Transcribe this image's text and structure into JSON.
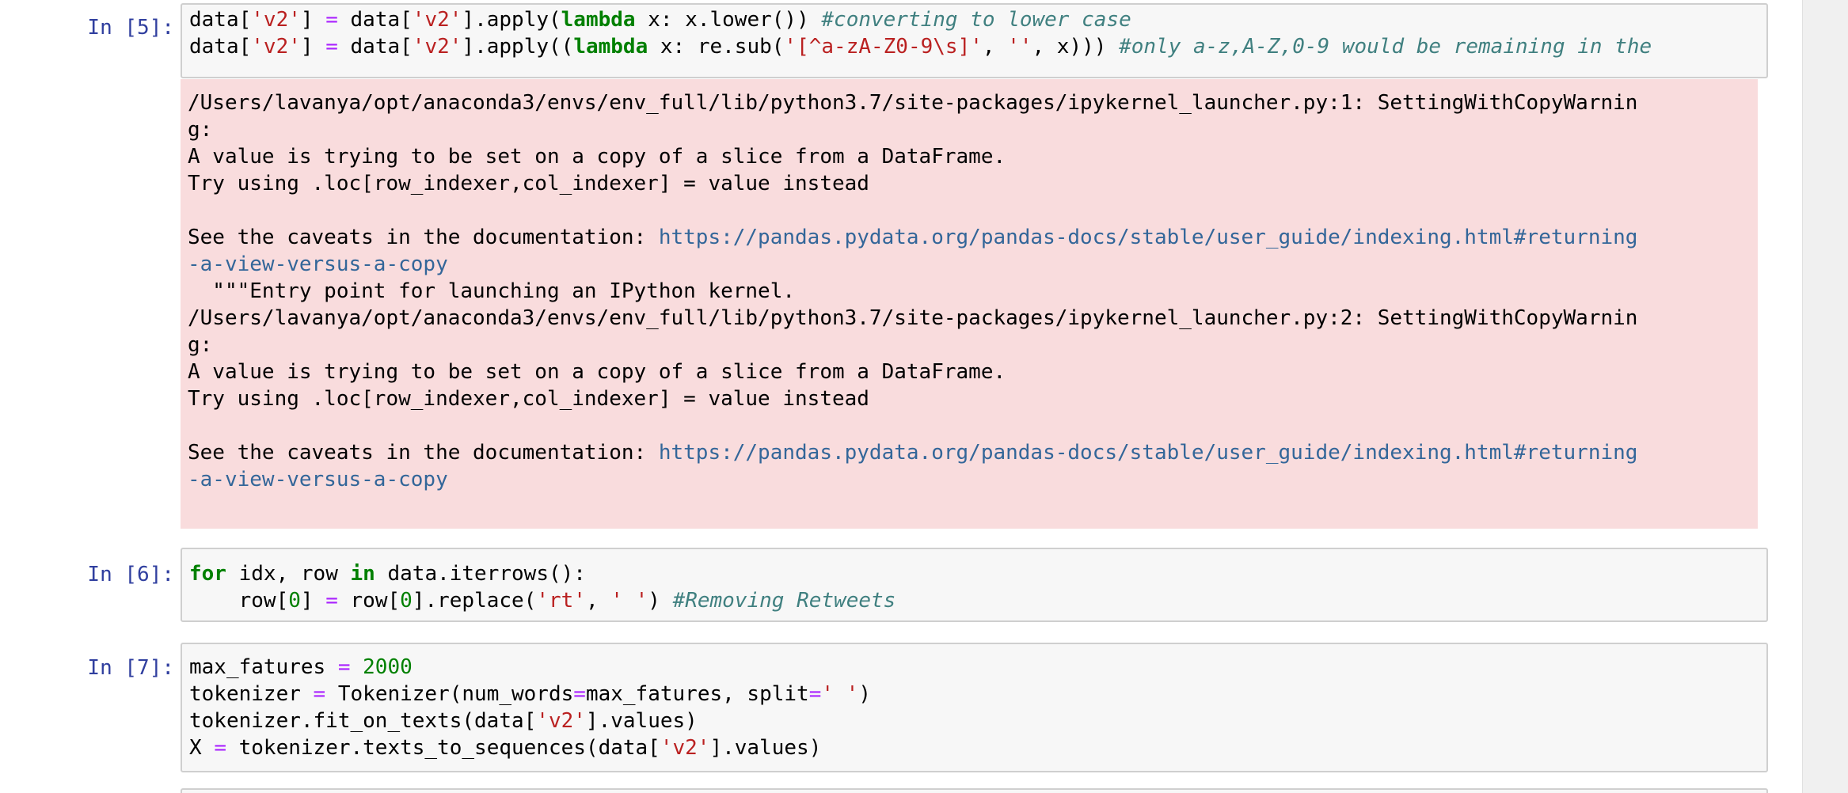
{
  "cells": [
    {
      "prompt": "In [5]:",
      "code": {
        "l1": {
          "a": "data[",
          "b": "'v2'",
          "c": "] ",
          "d": "=",
          "e": " data[",
          "f": "'v2'",
          "g": "].apply(",
          "h": "lambda",
          "i": " x: x.lower()) ",
          "j": "#converting to lower case"
        },
        "l2": {
          "a": "data[",
          "b": "'v2'",
          "c": "] ",
          "d": "=",
          "e": " data[",
          "f": "'v2'",
          "g": "].apply((",
          "h": "lambda",
          "i": " x: re.sub(",
          "j": "'[^a-zA-Z0-9\\s]'",
          "k": ", ",
          "l": "''",
          "m": ", x))) ",
          "n": "#only a-z,A-Z,0-9 would be remaining in the"
        }
      },
      "stderr": {
        "w1_path": "/Users/lavanya/opt/anaconda3/envs/env_full/lib/python3.7/site-packages/ipykernel_launcher.py:1: SettingWithCopyWarnin",
        "w1_cont": "g:",
        "w1_msg": "A value is trying to be set on a copy of a slice from a DataFrame.",
        "w1_try": "Try using .loc[row_indexer,col_indexer] = value instead",
        "w1_see": "See the caveats in the documentation: ",
        "w1_url_a": "https://pandas.pydata.org/pandas-docs/stable/user_guide/indexing.html#returning",
        "w1_url_b": "-a-view-versus-a-copy",
        "entry": "  \"\"\"Entry point for launching an IPython kernel.",
        "w2_path": "/Users/lavanya/opt/anaconda3/envs/env_full/lib/python3.7/site-packages/ipykernel_launcher.py:2: SettingWithCopyWarnin",
        "w2_cont": "g:",
        "w2_msg": "A value is trying to be set on a copy of a slice from a DataFrame.",
        "w2_try": "Try using .loc[row_indexer,col_indexer] = value instead",
        "w2_see": "See the caveats in the documentation: ",
        "w2_url_a": "https://pandas.pydata.org/pandas-docs/stable/user_guide/indexing.html#returning",
        "w2_url_b": "-a-view-versus-a-copy"
      }
    },
    {
      "prompt": "In [6]:",
      "code": {
        "l1": {
          "a": "for",
          "b": " idx, row ",
          "c": "in",
          "d": " data.iterrows():"
        },
        "l2": {
          "a": "    row[",
          "b": "0",
          "c": "] ",
          "d": "=",
          "e": " row[",
          "f": "0",
          "g": "].replace(",
          "h": "'rt'",
          "i": ", ",
          "j": "' '",
          "k": ") ",
          "l": "#Removing Retweets"
        }
      }
    },
    {
      "prompt": "In [7]:",
      "code": {
        "l1": {
          "a": "max_fatures ",
          "b": "=",
          "c": " ",
          "d": "2000"
        },
        "l2": {
          "a": "tokenizer ",
          "b": "=",
          "c": " Tokenizer(num_words",
          "d": "=",
          "e": "max_fatures, split",
          "f": "=",
          "g": "' '",
          "h": ")"
        },
        "l3": {
          "a": "tokenizer.fit_on_texts(data[",
          "b": "'v2'",
          "c": "].values)"
        },
        "l4": {
          "a": "X ",
          "b": "=",
          "c": " tokenizer.texts_to_sequences(data[",
          "d": "'v2'",
          "e": "].values)"
        }
      }
    }
  ]
}
